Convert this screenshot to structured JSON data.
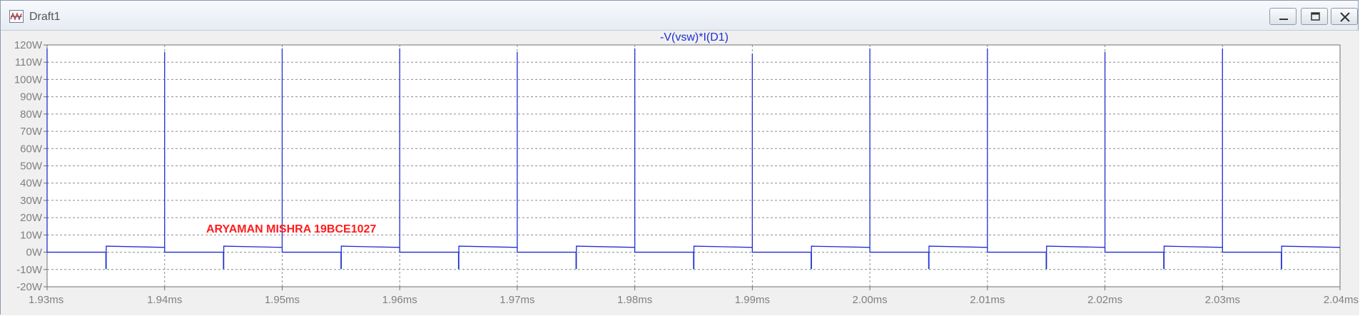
{
  "window": {
    "title": "Draft1",
    "app_icon": "ltspice-waveform-icon",
    "controls": [
      "minimize-icon",
      "restore-icon",
      "close-icon"
    ]
  },
  "colors": {
    "trace": "#1f2fd0",
    "grid": "#8c8c8c",
    "ticks": "#808080",
    "annotation": "#ff1b1b",
    "background": "#f0f0f0"
  },
  "chart_data": {
    "type": "line",
    "title": "-V(vsw)*I(D1)",
    "xlim": [
      1.93,
      2.04
    ],
    "ylim": [
      -20,
      120
    ],
    "x_ticks": [
      1.93,
      1.94,
      1.95,
      1.96,
      1.97,
      1.98,
      1.99,
      2.0,
      2.01,
      2.02,
      2.03,
      2.04
    ],
    "x_tick_labels": [
      "1.93ms",
      "1.94ms",
      "1.95ms",
      "1.96ms",
      "1.97ms",
      "1.98ms",
      "1.99ms",
      "2.00ms",
      "2.01ms",
      "2.02ms",
      "2.03ms",
      "2.04ms"
    ],
    "y_ticks": [
      -20,
      -10,
      0,
      10,
      20,
      30,
      40,
      50,
      60,
      70,
      80,
      90,
      100,
      110,
      120
    ],
    "y_tick_labels": [
      "-20W",
      "-10W",
      "0W",
      "10W",
      "20W",
      "30W",
      "40W",
      "50W",
      "60W",
      "70W",
      "80W",
      "90W",
      "100W",
      "110W",
      "120W"
    ],
    "grid": true,
    "annotation": "ARYAMAN MISHRA 19BCE1027",
    "series": [
      {
        "period_ms": 0.01,
        "spike_times_ms": [
          1.93,
          1.94,
          1.95,
          1.96,
          1.97,
          1.98,
          1.99,
          2.0,
          2.01,
          2.02,
          2.03
        ],
        "spike_peaks_w": [
          118,
          116,
          118,
          118,
          116,
          118,
          115,
          118,
          118,
          116,
          118
        ],
        "negative_step_times_ms": [
          1.935,
          1.945,
          1.955,
          1.965,
          1.975,
          1.985,
          1.995,
          2.005,
          2.015,
          2.025,
          2.035
        ],
        "negative_step_value_w": -9.5,
        "plateau_start_w": 3.5,
        "plateau_end_w": 2.8,
        "baseline_w": 0
      }
    ]
  }
}
